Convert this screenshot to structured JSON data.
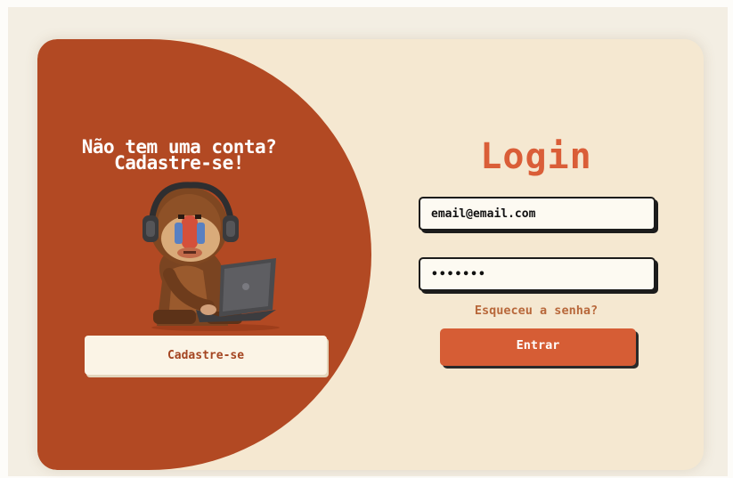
{
  "signup_panel": {
    "heading_line1": "Não tem uma conta?",
    "heading_line2": "Cadastre-se!",
    "mascot_icon": "monkey-with-headphones-and-laptop-icon",
    "signup_button_label": "Cadastre-se"
  },
  "login_panel": {
    "title": "Login",
    "email_value": "email@email.com",
    "password_value": "•••••••",
    "forgot_password_label": "Esqueceu a senha?",
    "submit_label": "Entrar"
  },
  "colors": {
    "brand_primary": "#b24923",
    "accent": "#d65d35",
    "card_background": "#f5e8d1"
  }
}
